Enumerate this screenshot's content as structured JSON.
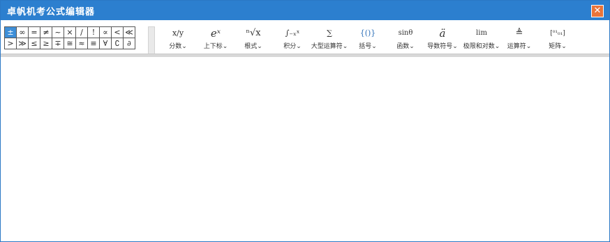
{
  "window": {
    "title": "卓帆机考公式编辑器",
    "close_label": "✕"
  },
  "symbols": {
    "row1": [
      "±",
      "∞",
      "=",
      "≠",
      "~",
      "×",
      "/",
      "!",
      "∝",
      "<",
      "≪"
    ],
    "row2": [
      ">",
      "≫",
      "≤",
      "≥",
      "∓",
      "≅",
      "≈",
      "≡",
      "∀",
      "∁",
      "∂"
    ]
  },
  "tools": [
    {
      "icon_text": "x/y",
      "label": "分数⌄",
      "icon": "fraction-icon"
    },
    {
      "icon_text": "eˣ",
      "label": "上下标⌄",
      "icon": "script-icon"
    },
    {
      "icon_text": "ⁿ√x",
      "label": "根式⌄",
      "icon": "radical-icon"
    },
    {
      "icon_text": "∫₋ₓˣ",
      "label": "积分⌄",
      "icon": "integral-icon"
    },
    {
      "icon_text": "∑",
      "label": "大型运算符⌄",
      "icon": "large-operator-icon"
    },
    {
      "icon_text": "{()}",
      "label": "括号⌄",
      "icon": "bracket-icon"
    },
    {
      "icon_text": "sinθ",
      "label": "函数⌄",
      "icon": "function-icon"
    },
    {
      "icon_text": "ä",
      "label": "导数符号⌄",
      "icon": "accent-icon"
    },
    {
      "icon_text": "lim",
      "label": "极限和对数⌄",
      "icon": "limit-log-icon"
    },
    {
      "icon_text": "≜",
      "label": "运算符⌄",
      "icon": "operator-icon"
    },
    {
      "icon_text": "[⁰¹₀₁]",
      "label": "矩阵⌄",
      "icon": "matrix-icon"
    }
  ],
  "grid_more_label": "▾",
  "colors": {
    "titlebar": "#2c7fcf",
    "close": "#e8743a",
    "selected_symbol": "#3e8fd8"
  }
}
